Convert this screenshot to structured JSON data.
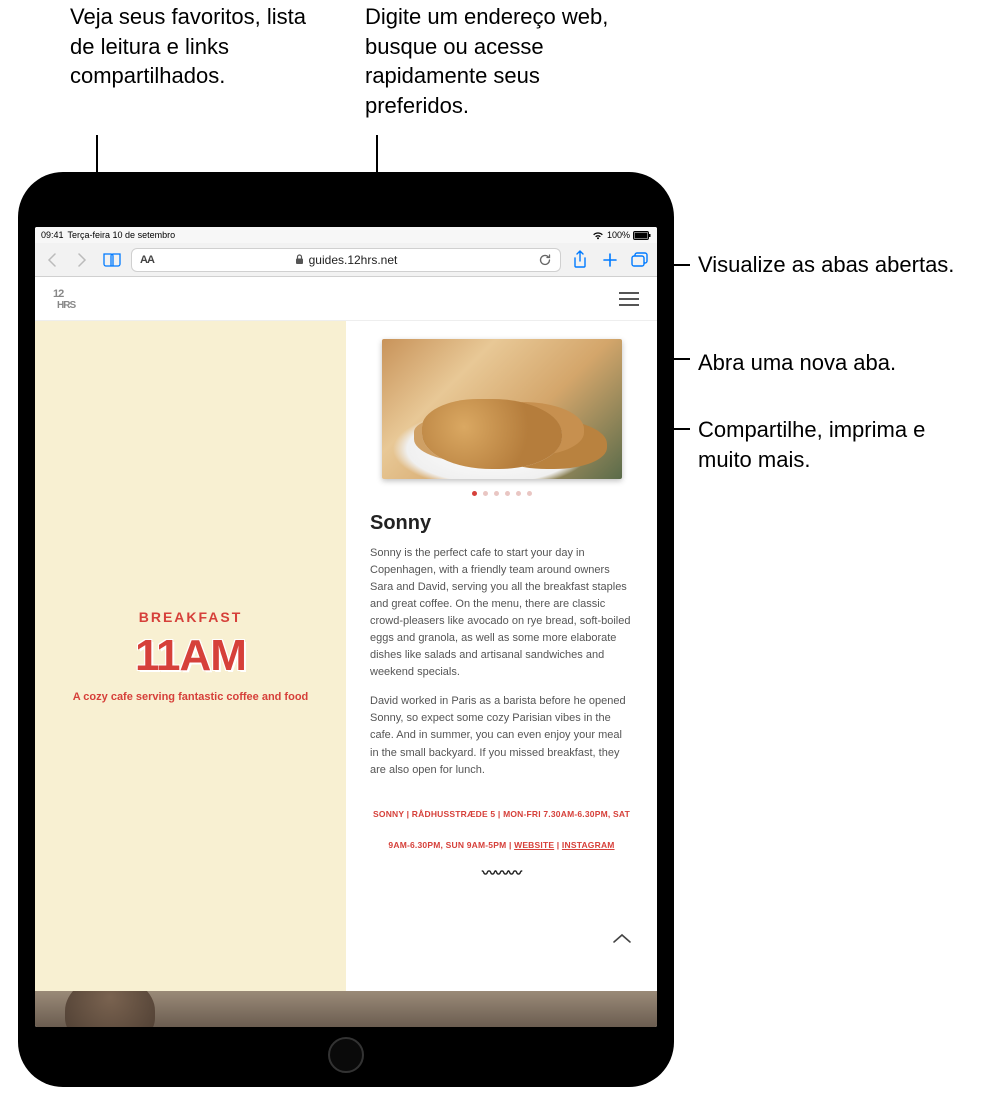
{
  "callouts": {
    "bookmarks": "Veja seus favoritos, lista de leitura e links compartilhados.",
    "address": "Digite um endereço web, busque ou acesse rapidamente seus preferidos.",
    "tabs": "Visualize as abas abertas.",
    "newtab": "Abra uma nova aba.",
    "share": "Compartilhe, imprima e muito mais."
  },
  "status": {
    "time": "09:41",
    "date": "Terça-feira 10 de setembro",
    "battery_pct": "100%"
  },
  "toolbar": {
    "url_display": "guides.12hrs.net",
    "aa_label": "AA"
  },
  "page": {
    "logo": "12 HRS",
    "left": {
      "eyebrow": "BREAKFAST",
      "time": "11AM",
      "sub": "A cozy cafe serving fantastic coffee and food"
    },
    "article": {
      "title": "Sonny",
      "p1": "Sonny is the perfect cafe to start your day in Copenhagen, with a friendly team around owners Sara and David, serving you all the breakfast staples and great coffee. On the menu, there are classic crowd-pleasers like avocado on rye bread, soft-boiled eggs and granola, as well as some more elaborate dishes like salads and artisanal sandwiches and weekend specials.",
      "p2": "David worked in Paris as a barista before he opened Sonny, so expect some cozy Parisian vibes in the cafe. And in summer, you can even enjoy your meal in the small backyard. If you missed breakfast, they are also open for lunch.",
      "info1": "SONNY | RÅDHUSSTRÆDE 5 | MON-FRI 7.30AM-6.30PM, SAT",
      "info2_prefix": "9AM-6.30PM, SUN 9AM-5PM | ",
      "info2_link1": "WEBSITE",
      "info2_sep": " | ",
      "info2_link2": "INSTAGRAM"
    }
  },
  "colors": {
    "accent_blue": "#007aff",
    "accent_red": "#d6403a",
    "cream": "#f8f0d2"
  }
}
